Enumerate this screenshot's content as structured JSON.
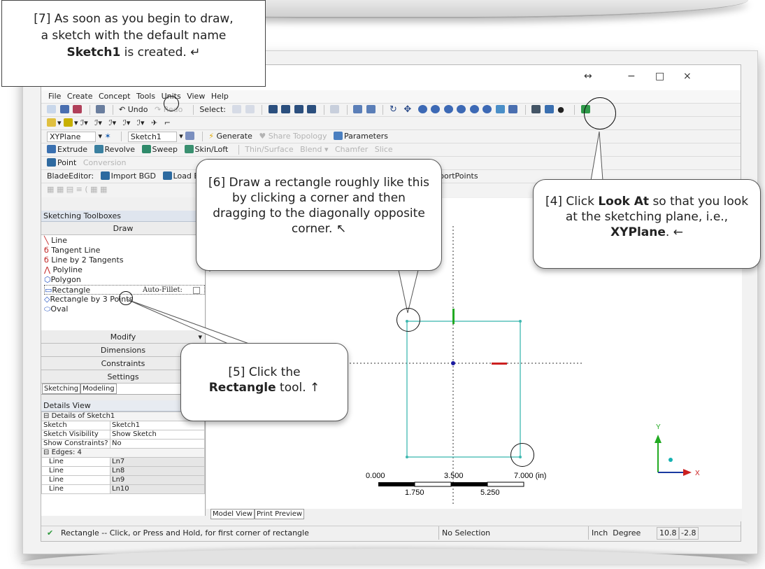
{
  "callouts": {
    "c7_line1": "[7] As soon as you begin to draw,",
    "c7_line2": "a sketch with the default name",
    "c7_bold": "Sketch1",
    "c7_rest": " is created. ↵",
    "c6": "[6] Draw a rectangle roughly like this by clicking a corner and then dragging to the diagonally opposite corner. ↖",
    "c4_pre": "[4] Click ",
    "c4_bold": "Look At",
    "c4_mid": " so that you look at the sketching plane, i.e., ",
    "c4_bold2": "XYPlane",
    "c4_post": ". ←",
    "c5_pre": "[5] Click the",
    "c5_bold": "Rectangle",
    "c5_post": " tool. ↑"
  },
  "window": {
    "controls": {
      "restore": "↔",
      "minimize": "−",
      "maximize": "□",
      "close": "×"
    }
  },
  "menu": [
    "File",
    "Create",
    "Concept",
    "Tools",
    "Units",
    "View",
    "Help"
  ],
  "toolbar1": {
    "undo": "Undo",
    "redo": "Redo",
    "select": "Select:"
  },
  "toolbar3": {
    "plane": "XYPlane",
    "sketch": "Sketch1",
    "generate": "Generate",
    "share_topology": "Share Topology",
    "parameters": "Parameters"
  },
  "toolbar4": {
    "extrude": "Extrude",
    "revolve": "Revolve",
    "sweep": "Sweep",
    "skin_loft": "Skin/Loft",
    "thin_surface": "Thin/Surface",
    "blend": "Blend ▾",
    "chamfer": "Chamfer",
    "slice": "Slice"
  },
  "toolbar5": {
    "point": "Point",
    "conversion": "Conversion"
  },
  "toolbar6": {
    "bladeeditor": "BladeEditor:",
    "import_bgd": "Import BGD",
    "load_bgd": "Load BGD",
    "export": "port",
    "export_points": "ExportPoints"
  },
  "sketching": {
    "title": "Sketching Toolboxes",
    "draw": "Draw",
    "tools": [
      "Line",
      "Tangent Line",
      "Line by 2 Tangents",
      "Polyline",
      "Polygon",
      "Rectangle",
      "Rectangle by 3 Points",
      "Oval"
    ],
    "auto_fillet": "Auto-Fillet:",
    "groups": [
      "Modify",
      "Dimensions",
      "Constraints",
      "Settings"
    ],
    "tabs": [
      "Sketching",
      "Modeling"
    ]
  },
  "details": {
    "title": "Details View",
    "section": "Details of Sketch1",
    "rows": [
      {
        "k": "Sketch",
        "v": "Sketch1"
      },
      {
        "k": "Sketch Visibility",
        "v": "Show Sketch"
      },
      {
        "k": "Show Constraints?",
        "v": "No"
      }
    ],
    "edges_header": "Edges: 4",
    "edges": [
      {
        "k": "Line",
        "v": "Ln7"
      },
      {
        "k": "Line",
        "v": "Ln8"
      },
      {
        "k": "Line",
        "v": "Ln9"
      },
      {
        "k": "Line",
        "v": "Ln10"
      }
    ]
  },
  "scale": {
    "t0": "0.000",
    "t1": "3.500",
    "t2": "7.000 (in)",
    "b1": "1.750",
    "b2": "5.250"
  },
  "triad": {
    "y": "Y",
    "x": "X"
  },
  "view_tabs": [
    "Model View",
    "Print Preview"
  ],
  "status": {
    "message": "Rectangle -- Click, or Press and Hold, for first corner of rectangle",
    "selection": "No Selection",
    "units": "Inch  Degree",
    "coord1": "10.8",
    "coord2": "-2.8"
  },
  "colors": {
    "sketch_line": "#3fb8b0",
    "x_axis": "#cc2020",
    "y_axis": "#22aa22",
    "origin": "#1a1aa0"
  }
}
